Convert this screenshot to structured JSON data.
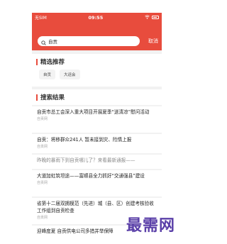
{
  "status": {
    "carrier": "无SIM",
    "time": "09:55",
    "icons": [
      "wifi-icon",
      "battery-icon"
    ]
  },
  "search": {
    "value": "自贡",
    "cancel": "取消"
  },
  "featured": {
    "title": "精选推荐",
    "chips": [
      "自贡",
      "大运会"
    ]
  },
  "results": {
    "title": "搜索结果",
    "items": [
      {
        "title": "自贡市总工会深入重大项目开展夏季“送清凉”慰问活动",
        "source": "自贡网"
      },
      {
        "title": "自贡：将移群众241人 暂未接到灾、险情上报",
        "source": "自贡网"
      },
      {
        "title": "昨晚的暴雨下到自贡哪儿了？来看最新通报——",
        "source": ""
      },
      {
        "title": "大道加虹筑坦途——富顺县全力抓好“交通强县”建设",
        "source": "自贡网"
      },
      {
        "title": "省第十二届双拥模范（先进）城（县、区）创建考核验收工作组到自贡检查",
        "source": "自贡网"
      },
      {
        "title": "迎峰度夏 自贡供电公司多措并举保障",
        "source": ""
      }
    ]
  },
  "watermark": "最需网",
  "colors": {
    "accent": "#e84c3d",
    "watermark": "#5a3fa8"
  }
}
